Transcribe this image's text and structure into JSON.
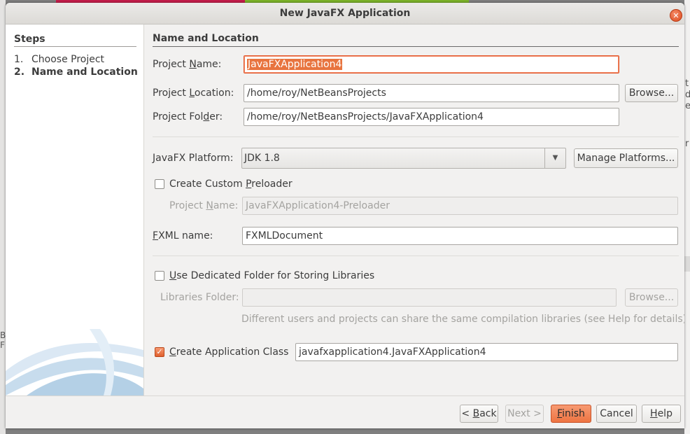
{
  "dialog": {
    "title": "New JavaFX Application",
    "close_icon": "close-icon",
    "accent_color": "#e9683a"
  },
  "steps": {
    "heading": "Steps",
    "items": [
      {
        "num": "1.",
        "label": "Choose Project",
        "current": false
      },
      {
        "num": "2.",
        "label": "Name and Location",
        "current": true
      }
    ]
  },
  "main": {
    "section_title": "Name and Location",
    "project_name": {
      "label_pre": "Project ",
      "label_mn": "N",
      "label_post": "ame:",
      "value": "JavaFXApplication4"
    },
    "project_location": {
      "label_pre": "Project ",
      "label_mn": "L",
      "label_post": "ocation:",
      "value": "/home/roy/NetBeansProjects",
      "browse": "Browse..."
    },
    "project_folder": {
      "label_pre": "Project Fol",
      "label_mn": "d",
      "label_post": "er:",
      "value": "/home/roy/NetBeansProjects/JavaFXApplication4"
    },
    "platform": {
      "label_pre": "",
      "label_mn": "J",
      "label_post": "avaFX Platform:",
      "value": "JDK 1.8",
      "manage": "Manage Platforms..."
    },
    "preloader": {
      "label_pre": "Create Custom ",
      "label_mn": "P",
      "label_post": "reloader",
      "checked": false,
      "project_name_label_pre": "Project ",
      "project_name_label_mn": "N",
      "project_name_label_post": "ame:",
      "project_name_value": "JavaFXApplication4-Preloader"
    },
    "fxml": {
      "label_pre": "",
      "label_mn": "F",
      "label_post": "XML name:",
      "value": "FXMLDocument"
    },
    "libraries": {
      "label_pre": "",
      "label_mn": "U",
      "label_post": "se Dedicated Folder for Storing Libraries",
      "checked": false,
      "folder_label": "Libraries Folder:",
      "folder_value": "",
      "browse": "Browse...",
      "hint": "Different users and projects can share the same compilation libraries (see Help for details)."
    },
    "app_class": {
      "label_pre": "",
      "label_mn": "C",
      "label_post": "reate Application Class",
      "checked": true,
      "value": "javafxapplication4.JavaFXApplication4"
    }
  },
  "footer": {
    "back": {
      "pre": "< ",
      "mn": "B",
      "post": "ack"
    },
    "next": "Next >",
    "finish": {
      "mn": "F",
      "post": "inish"
    },
    "cancel": "Cancel",
    "help": {
      "mn": "H",
      "post": "elp"
    }
  }
}
